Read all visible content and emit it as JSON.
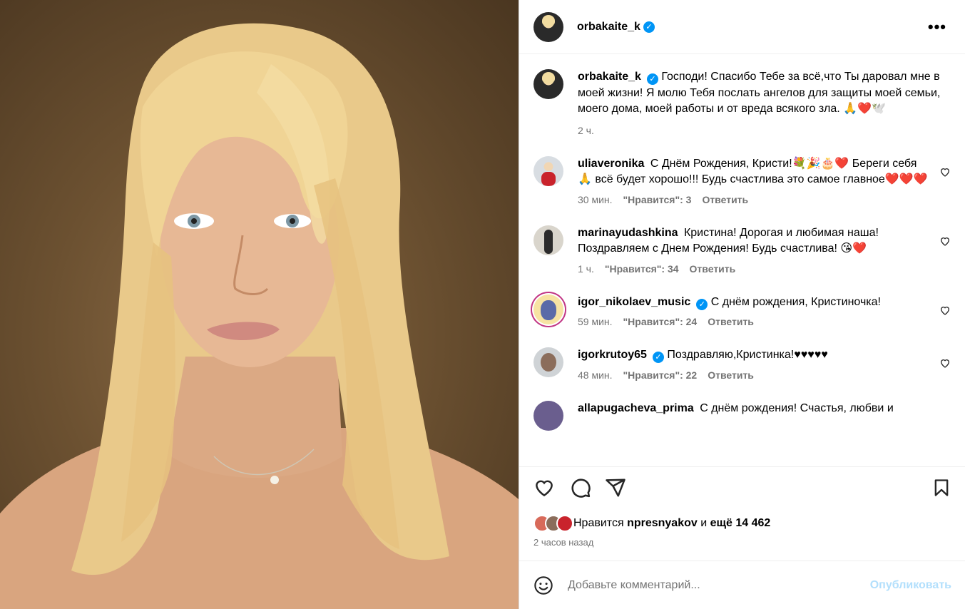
{
  "post": {
    "author": "orbakaite_k",
    "more_icon": "more-icon"
  },
  "caption": {
    "user": "orbakaite_k",
    "text": "Господи! Спасибо Тебе за всё,что Ты даровал мне в моей жизни! Я молю Тебя послать ангелов для защиты моей семьи, моего дома, моей работы и от вреда всякого зла. 🙏❤️🕊️",
    "time": "2 ч."
  },
  "comments": [
    {
      "user": "uliaveronika",
      "verified": false,
      "text": "С Днём Рождения, Кристи!💐🎉🎂❤️ Береги себя🙏 всё будет хорошо!!! Будь счастлива это самое главное❤️❤️❤️",
      "time": "30 мин.",
      "likes": "\"Нравится\": 3",
      "reply": "Ответить"
    },
    {
      "user": "marinayudashkina",
      "verified": false,
      "text": "Кристина! Дорогая и любимая наша! Поздравляем с Днем Рождения! Будь счастлива! 😘❤️",
      "time": "1 ч.",
      "likes": "\"Нравится\": 34",
      "reply": "Ответить"
    },
    {
      "user": "igor_nikolaev_music",
      "verified": true,
      "text": "С днём рождения, Кристиночка!",
      "time": "59 мин.",
      "likes": "\"Нравится\": 24",
      "reply": "Ответить"
    },
    {
      "user": "igorkrutoy65",
      "verified": true,
      "text": "Поздравляю,Кристинка!♥♥♥♥♥",
      "time": "48 мин.",
      "likes": "\"Нравится\": 22",
      "reply": "Ответить"
    },
    {
      "user": "allapugacheva_prima",
      "verified": false,
      "text": "С днём рождения! Счастья, любви и",
      "time": "",
      "likes": "",
      "reply": ""
    }
  ],
  "likes": {
    "prefix": "Нравится",
    "user": "npresnyakov",
    "joiner": "и",
    "rest": "ещё 14 462"
  },
  "posted_ago": "2 часов назад",
  "add_comment": {
    "placeholder": "Добавьте комментарий...",
    "publish": "Опубликовать"
  },
  "colors": {
    "verified": "#0095f6",
    "publish_disabled": "#b2dffc",
    "meta": "#737373"
  }
}
